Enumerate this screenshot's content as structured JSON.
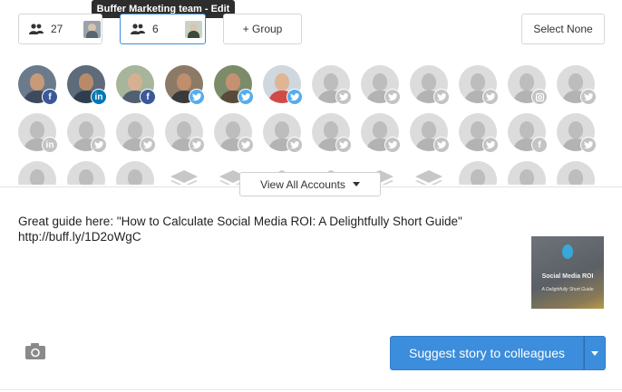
{
  "tooltip": {
    "text": "Buffer Marketing team - Edit"
  },
  "groups": [
    {
      "count": "27",
      "selected": false
    },
    {
      "count": "6",
      "selected": true
    }
  ],
  "add_group_label": "+ Group",
  "select_none_label": "Select None",
  "view_all_label": "View All Accounts",
  "composer": {
    "text_line1": "Great guide here: \"How to Calculate Social Media ROI: A Delightfully Short Guide\"",
    "text_line2": "http://buff.ly/1D2oWgC"
  },
  "preview": {
    "title": "Social Media ROI",
    "subtitle": "A Delightfully Short Guide"
  },
  "submit_label": "Suggest story to colleagues",
  "colors": {
    "facebook": "#3b5998",
    "linkedin": "#0077b5",
    "twitter": "#55acee",
    "primary": "#3c8ddb"
  },
  "accounts": [
    {
      "network": "facebook",
      "active": true
    },
    {
      "network": "linkedin",
      "active": true
    },
    {
      "network": "facebook",
      "active": true
    },
    {
      "network": "twitter",
      "active": true
    },
    {
      "network": "twitter",
      "active": true
    },
    {
      "network": "twitter",
      "active": true
    },
    {
      "network": "twitter",
      "active": false
    },
    {
      "network": "twitter",
      "active": false
    },
    {
      "network": "twitter",
      "active": false
    },
    {
      "network": "twitter",
      "active": false
    },
    {
      "network": "instagram",
      "active": false
    },
    {
      "network": "twitter",
      "active": false
    },
    {
      "network": "linkedin",
      "active": false
    },
    {
      "network": "twitter",
      "active": false
    },
    {
      "network": "twitter",
      "active": false
    },
    {
      "network": "twitter",
      "active": false
    },
    {
      "network": "twitter",
      "active": false
    },
    {
      "network": "twitter",
      "active": false
    },
    {
      "network": "twitter",
      "active": false
    },
    {
      "network": "twitter",
      "active": false
    },
    {
      "network": "twitter",
      "active": false
    },
    {
      "network": "twitter",
      "active": false
    },
    {
      "network": "facebook",
      "active": false
    },
    {
      "network": "twitter",
      "active": false
    },
    {
      "network": "twitter",
      "active": false
    },
    {
      "network": "twitter",
      "active": false
    },
    {
      "network": "twitter",
      "active": false
    },
    {
      "network": "stack",
      "active": false
    },
    {
      "network": "stack",
      "active": false
    },
    {
      "network": "stack",
      "active": false
    },
    {
      "network": "stack",
      "active": false
    },
    {
      "network": "stack",
      "active": false
    },
    {
      "network": "stack",
      "active": false
    },
    {
      "network": "twitter",
      "active": false
    },
    {
      "network": "twitter",
      "active": false
    },
    {
      "network": "twitter",
      "active": false
    },
    {
      "network": "twitter",
      "active": false
    }
  ]
}
